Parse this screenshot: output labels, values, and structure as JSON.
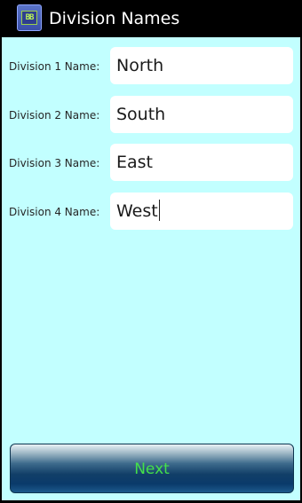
{
  "titlebar": {
    "title": "Division Names",
    "icon": "app-logo-icon",
    "icon_text": "BB"
  },
  "form": {
    "rows": [
      {
        "label": "Division 1 Name:",
        "value": "North"
      },
      {
        "label": "Division 2 Name:",
        "value": "South"
      },
      {
        "label": "Division 3 Name:",
        "value": "East"
      },
      {
        "label": "Division 4 Name:",
        "value": "West"
      }
    ],
    "focused_row": 4
  },
  "footer": {
    "next_label": "Next"
  },
  "colors": {
    "background": "#c2ffff",
    "titlebar": "#000000",
    "button_text": "#44e04a",
    "button_base": "#0a3a6a"
  }
}
